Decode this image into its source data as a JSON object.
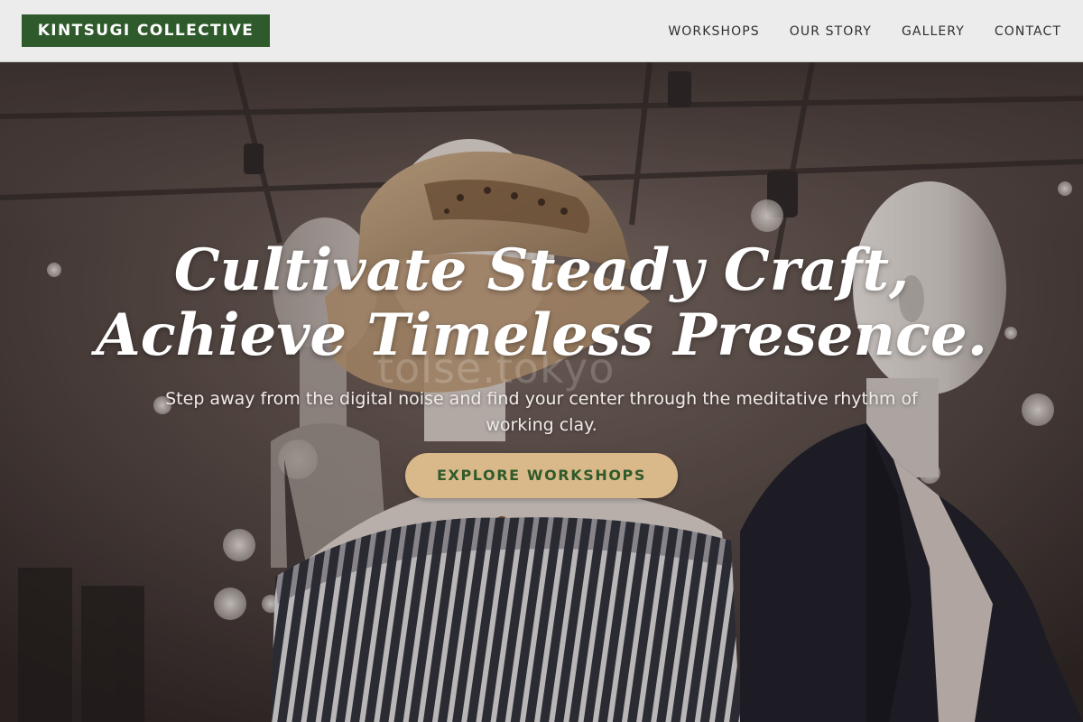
{
  "header": {
    "logo_text": "KINTSUGI COLLECTIVE",
    "nav": [
      {
        "label": "WORKSHOPS"
      },
      {
        "label": "OUR STORY"
      },
      {
        "label": "GALLERY"
      },
      {
        "label": "CONTACT"
      }
    ]
  },
  "hero": {
    "title_line1": "Cultivate Steady Craft,",
    "title_line2": "Achieve Timeless Presence.",
    "subtitle": "Step away from the digital noise and find your center through the meditative rhythm of working clay.",
    "cta_label": "EXPLORE WORKSHOPS",
    "background_image": "mannequins-in-retail-store",
    "watermark": "tolse.tokyo"
  },
  "colors": {
    "brand_green": "#2f5a2b",
    "cta_tan": "#d9b98a",
    "header_bg": "#ececec",
    "nav_text": "#2f2f2f"
  }
}
